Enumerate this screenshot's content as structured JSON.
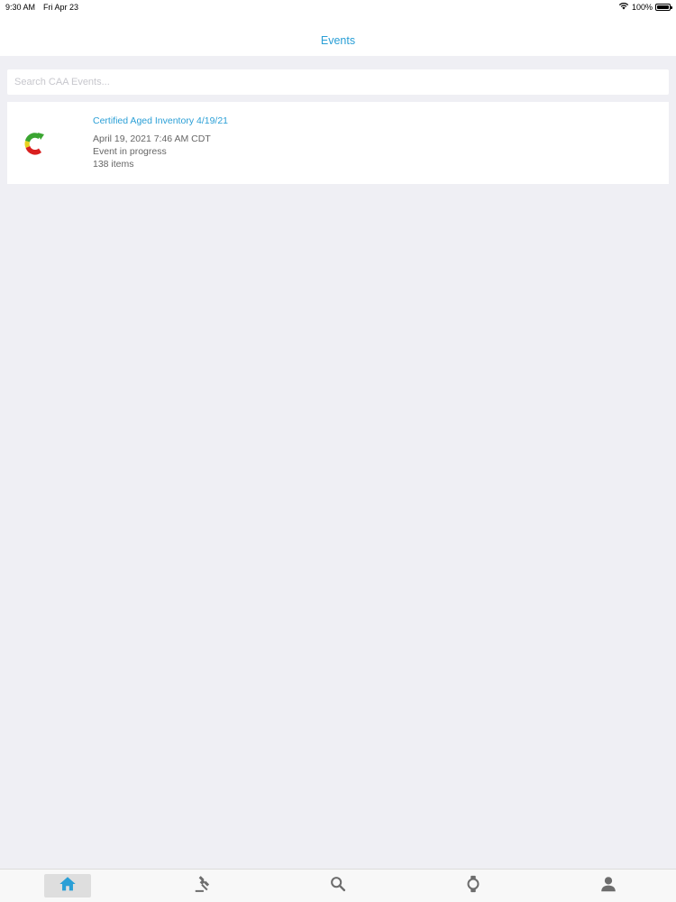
{
  "status_bar": {
    "time": "9:30 AM",
    "date": "Fri Apr 23",
    "battery": "100%"
  },
  "nav": {
    "title": "Events"
  },
  "search": {
    "placeholder": "Search CAA Events...",
    "value": ""
  },
  "events": [
    {
      "title": "Certified Aged Inventory 4/19/21",
      "date": "April 19, 2021 7:46 AM CDT",
      "status": "Event in progress",
      "items": "138 items",
      "logo_icon": "caa-logo-icon"
    }
  ],
  "tabs": [
    {
      "name": "home",
      "icon": "home-icon",
      "active": true
    },
    {
      "name": "auctions",
      "icon": "gavel-icon",
      "active": false
    },
    {
      "name": "search",
      "icon": "search-icon",
      "active": false
    },
    {
      "name": "watchlist",
      "icon": "watch-icon",
      "active": false
    },
    {
      "name": "account",
      "icon": "user-icon",
      "active": false
    }
  ],
  "colors": {
    "accent": "#2a9fd6",
    "background": "#efeff4",
    "tab_icon": "#6d6d6d",
    "tab_active_icon": "#2a9fd6"
  }
}
